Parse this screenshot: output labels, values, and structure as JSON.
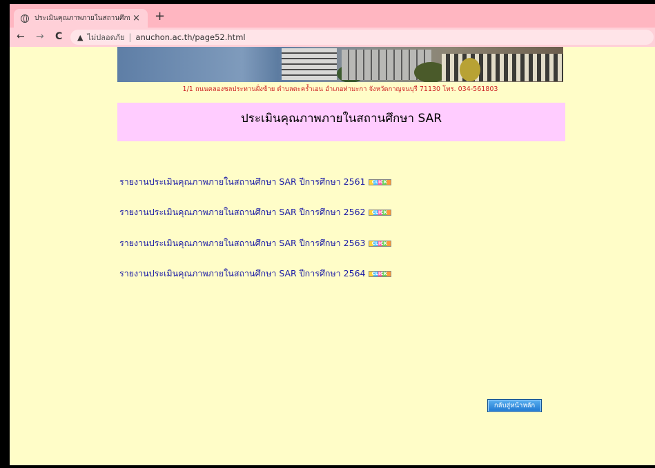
{
  "browser": {
    "tab_title": "ประเมินคุณภาพภายในสถานศึกษา",
    "tab_close": "×",
    "new_tab": "+",
    "back": "←",
    "forward": "→",
    "reload": "C",
    "security_icon": "warning-triangle-icon",
    "security_label": "ไม่ปลอดภัย",
    "url_separator": "|",
    "url": "anuchon.ac.th/page52.html",
    "colors": {
      "tabbar": "#ffb6c1",
      "toolbar": "#ffd0d8",
      "page_bg": "#fffdc8"
    }
  },
  "page": {
    "address": "1/1  ถนนคลองชลประทานฝั่งซ้าย  ตำบลตะคร้ำเอน  อำเภอท่ามะกา  จังหวัดกาญจนบุรี  71130  โทร. 034-561803",
    "title": "ประเมินคุณภาพภายในสถานศึกษา SAR",
    "links": [
      {
        "label": "รายงานประเมินคุณภาพภายในสถานศึกษา SAR ปีการศึกษา 2561",
        "badge": "CLICK"
      },
      {
        "label": "รายงานประเมินคุณภาพภายในสถานศึกษา SAR ปีการศึกษา 2562",
        "badge": "CLICK"
      },
      {
        "label": "รายงานประเมินคุณภาพภายในสถานศึกษา SAR ปีการศึกษา 2563",
        "badge": "CLICK"
      },
      {
        "label": "รายงานประเมินคุณภาพภายในสถานศึกษา SAR ปีการศึกษา 2564",
        "badge": "CLICK"
      }
    ],
    "home_button": "กลับสู่หน้าหลัก",
    "colors": {
      "title_bg": "#ffccff",
      "link": "#1a1aa6",
      "address": "#cc2222",
      "home_button": "#1f78d1"
    }
  }
}
